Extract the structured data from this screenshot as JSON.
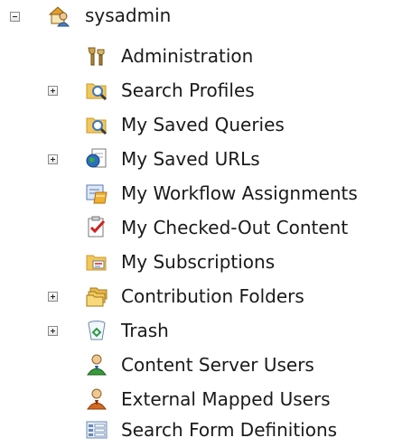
{
  "tree": {
    "root": {
      "label": "sysadmin",
      "icon": "user-home-icon",
      "expanded": true
    },
    "items": [
      {
        "label": "Administration",
        "icon": "admin-tools-icon",
        "expandable": false
      },
      {
        "label": "Search Profiles",
        "icon": "search-folder-icon",
        "expandable": true
      },
      {
        "label": "My Saved Queries",
        "icon": "search-folder-icon",
        "expandable": false
      },
      {
        "label": "My Saved URLs",
        "icon": "globe-page-icon",
        "expandable": true
      },
      {
        "label": "My Workflow Assignments",
        "icon": "workflow-icon",
        "expandable": false
      },
      {
        "label": "My Checked-Out Content",
        "icon": "checked-out-icon",
        "expandable": false
      },
      {
        "label": "My Subscriptions",
        "icon": "subscriptions-folder-icon",
        "expandable": false
      },
      {
        "label": "Contribution Folders",
        "icon": "folders-stack-icon",
        "expandable": true
      },
      {
        "label": "Trash",
        "icon": "trash-icon",
        "expandable": true
      },
      {
        "label": "Content Server Users",
        "icon": "user-green-icon",
        "expandable": false
      },
      {
        "label": "External Mapped Users",
        "icon": "user-orange-icon",
        "expandable": false
      },
      {
        "label": "Search Form Definitions",
        "icon": "form-definition-icon",
        "expandable": false
      }
    ]
  },
  "colors": {
    "text": "#1a1a1a",
    "folder": "#f2c75c",
    "folder_dark": "#c99a2e",
    "magnifier": "#3a78c2",
    "green": "#3a9a3a",
    "orange": "#d46a1e"
  }
}
